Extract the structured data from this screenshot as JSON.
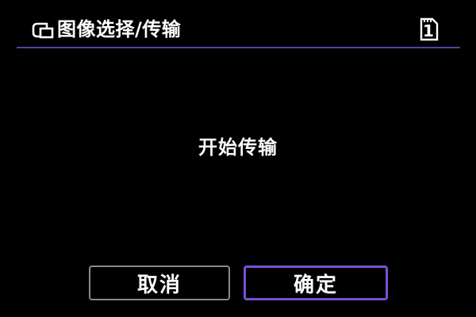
{
  "header": {
    "title": "图像选择/传输",
    "icon": "image-transfer-icon",
    "card_slot": "1",
    "card_icon": "memory-card-icon"
  },
  "dialog": {
    "message": "开始传输"
  },
  "buttons": {
    "cancel_label": "取消",
    "ok_label": "确定"
  },
  "colors": {
    "background": "#000000",
    "divider": "#5b3f9c",
    "selected_border": "#7b4fd6",
    "unselected_border": "#8a8a8a",
    "text": "#ffffff"
  }
}
